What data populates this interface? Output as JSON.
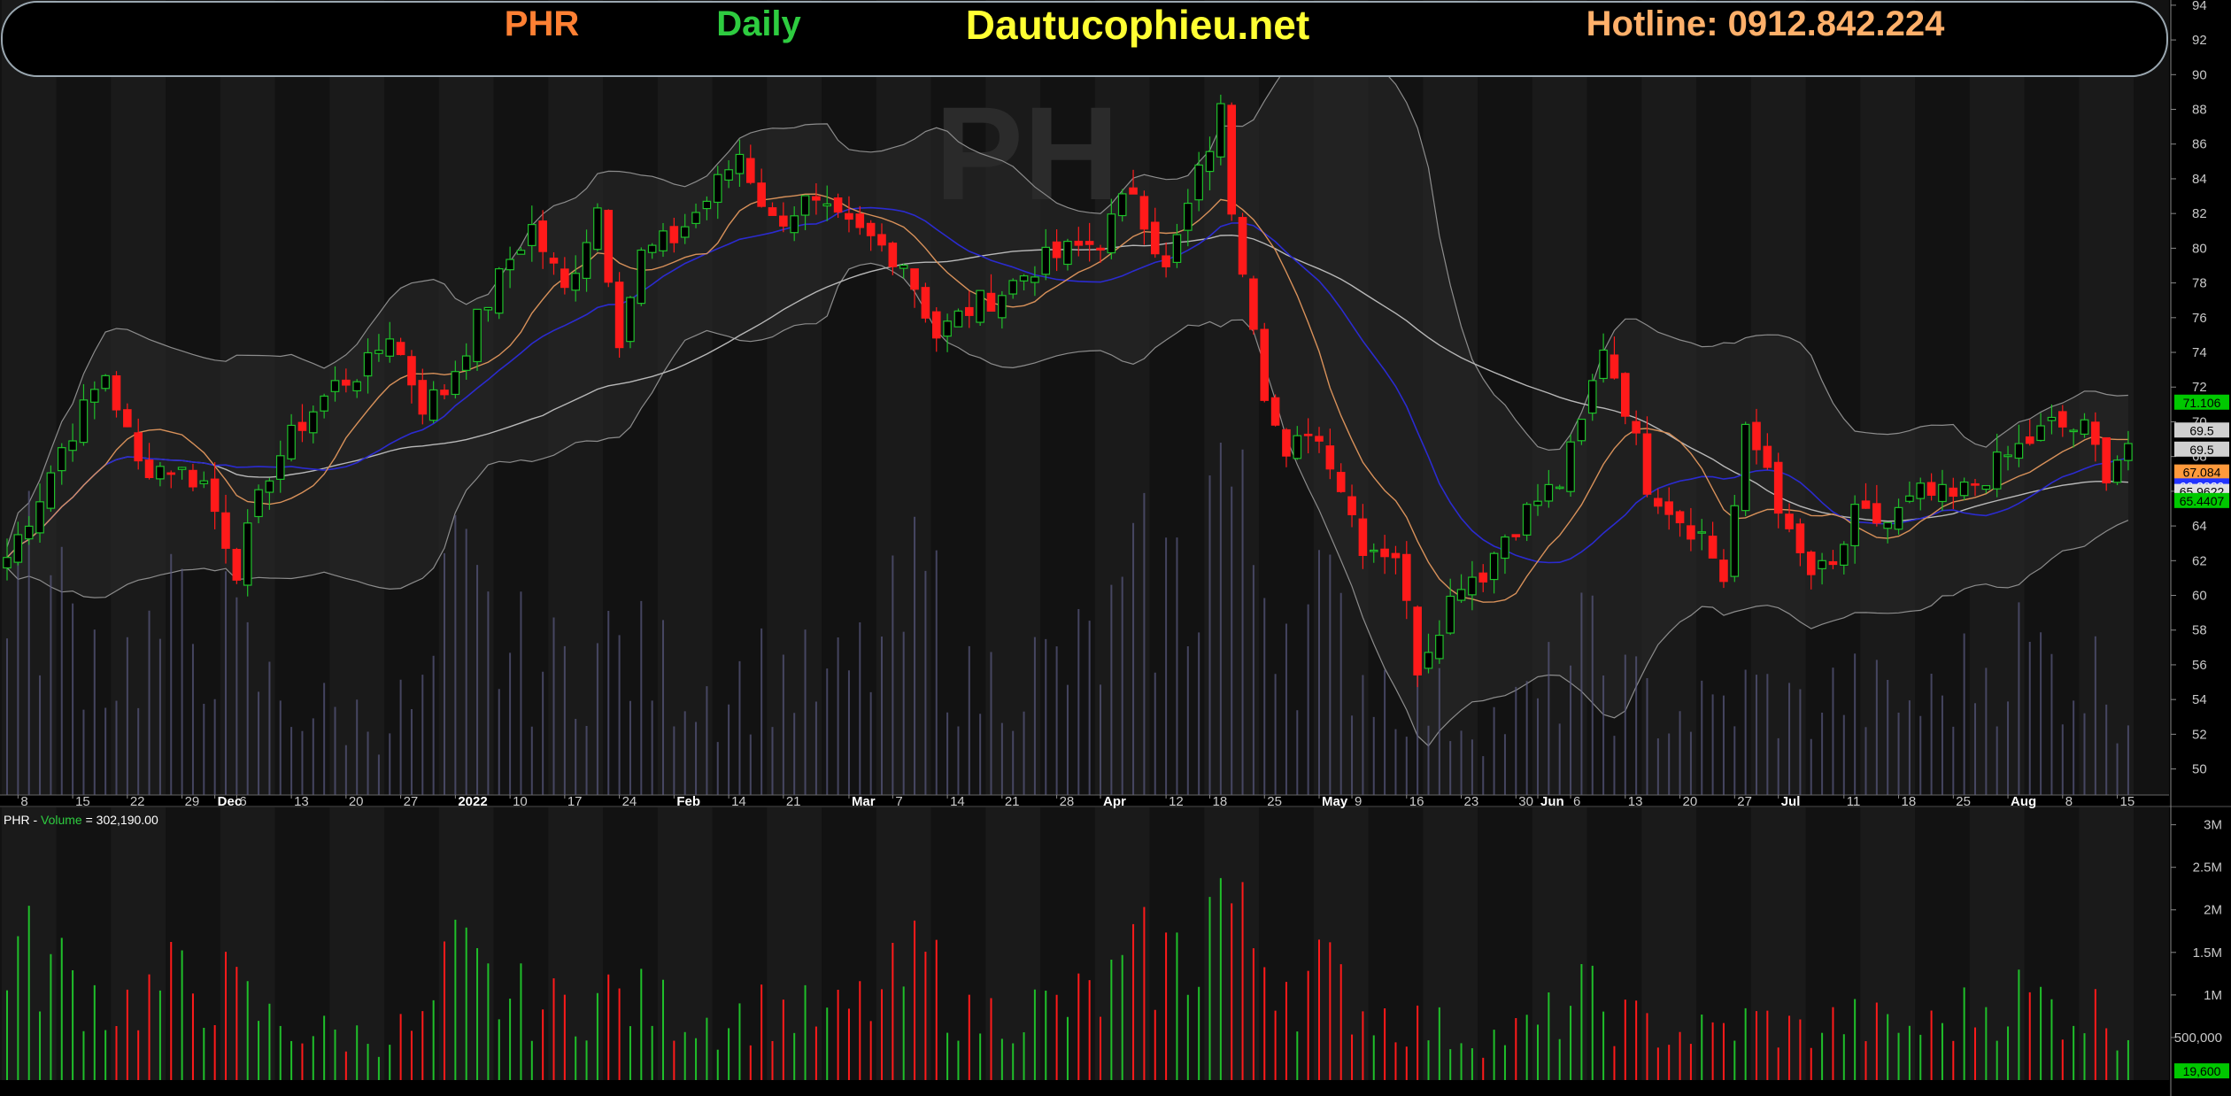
{
  "banner": {
    "symbol": "PHR",
    "interval": "Daily",
    "site": "Dautucophieu.net",
    "hotline": "Hotline: 0912.842.224",
    "watermark": "PH"
  },
  "colors": {
    "background": "#000000",
    "panel": "#121212",
    "up": "#1fbf2a",
    "down": "#ff1a1a",
    "ma_orange": "#d8915a",
    "ma_blue": "#2b2bd0",
    "ma_white": "#b8b8b8",
    "band": "#8c8c8c",
    "symbol": "#ff8033",
    "interval": "#2ecc40",
    "site": "#ffff33",
    "hotline": "#ffb06a"
  },
  "volume_legend": {
    "symbol": "PHR",
    "label": "Volume",
    "value": "= 302,190.00"
  },
  "chart_data": [
    {
      "type": "candlestick",
      "panel": "price",
      "y_ticks": [
        50,
        52,
        54,
        56,
        58,
        60,
        62,
        64,
        66,
        68,
        70,
        72,
        74,
        76,
        78,
        80,
        82,
        84,
        86,
        88,
        90,
        92,
        94
      ],
      "ylim": [
        48.5,
        94.3
      ],
      "date_labels": [
        {
          "t": "8",
          "i": 1
        },
        {
          "t": "15",
          "i": 6
        },
        {
          "t": "22",
          "i": 11
        },
        {
          "t": "29",
          "i": 16
        },
        {
          "t": "Dec",
          "i": 19,
          "bold": true
        },
        {
          "t": "6",
          "i": 21
        },
        {
          "t": "13",
          "i": 26
        },
        {
          "t": "20",
          "i": 31
        },
        {
          "t": "27",
          "i": 36
        },
        {
          "t": "2022",
          "i": 41,
          "bold": true
        },
        {
          "t": "10",
          "i": 46
        },
        {
          "t": "17",
          "i": 51
        },
        {
          "t": "24",
          "i": 56
        },
        {
          "t": "Feb",
          "i": 61,
          "bold": true
        },
        {
          "t": "14",
          "i": 66
        },
        {
          "t": "21",
          "i": 71
        },
        {
          "t": "Mar",
          "i": 77,
          "bold": true
        },
        {
          "t": "7",
          "i": 81
        },
        {
          "t": "14",
          "i": 86
        },
        {
          "t": "21",
          "i": 91
        },
        {
          "t": "28",
          "i": 96
        },
        {
          "t": "Apr",
          "i": 100,
          "bold": true
        },
        {
          "t": "12",
          "i": 106
        },
        {
          "t": "18",
          "i": 110
        },
        {
          "t": "25",
          "i": 115
        },
        {
          "t": "May",
          "i": 120,
          "bold": true
        },
        {
          "t": "9",
          "i": 123
        },
        {
          "t": "16",
          "i": 128
        },
        {
          "t": "23",
          "i": 133
        },
        {
          "t": "30",
          "i": 138
        },
        {
          "t": "Jun",
          "i": 140,
          "bold": true
        },
        {
          "t": "6",
          "i": 143
        },
        {
          "t": "13",
          "i": 148
        },
        {
          "t": "20",
          "i": 153
        },
        {
          "t": "27",
          "i": 158
        },
        {
          "t": "Jul",
          "i": 162,
          "bold": true
        },
        {
          "t": "11",
          "i": 168
        },
        {
          "t": "18",
          "i": 173
        },
        {
          "t": "25",
          "i": 178
        },
        {
          "t": "Aug",
          "i": 183,
          "bold": true
        },
        {
          "t": "8",
          "i": 188
        },
        {
          "t": "15",
          "i": 193
        }
      ],
      "last_values": [
        {
          "label": "71.106",
          "value": 71.106,
          "bg": "#00c800",
          "fg": "#000000"
        },
        {
          "label": "69.5",
          "value": 69.5,
          "bg": "#d0d0d0",
          "fg": "#000000"
        },
        {
          "label": "69.5",
          "value": 68.4,
          "bg": "#d0d0d0",
          "fg": "#000000"
        },
        {
          "label": "67.084",
          "value": 67.084,
          "bg": "#ff9a3c",
          "fg": "#000000"
        },
        {
          "label": "66.2829",
          "value": 66.2829,
          "bg": "#2233ff",
          "fg": "#ffffff"
        },
        {
          "label": "65.9622",
          "value": 65.9622,
          "bg": "#e0e0e0",
          "fg": "#000000"
        },
        {
          "label": "65.4407",
          "value": 65.4407,
          "bg": "#00c800",
          "fg": "#000000"
        }
      ],
      "anchors": [
        [
          0,
          62.2
        ],
        [
          3,
          65.8
        ],
        [
          5,
          68.5
        ],
        [
          9,
          72.8
        ],
        [
          12,
          67.5
        ],
        [
          15,
          67.4
        ],
        [
          18,
          66.5
        ],
        [
          21,
          61.6
        ],
        [
          24,
          67.2
        ],
        [
          27,
          70.0
        ],
        [
          30,
          72.1
        ],
        [
          33,
          73.2
        ],
        [
          35,
          75.2
        ],
        [
          38,
          71.0
        ],
        [
          40,
          71.8
        ],
        [
          43,
          75.8
        ],
        [
          46,
          79.4
        ],
        [
          48,
          81.2
        ],
        [
          51,
          77.5
        ],
        [
          54,
          82.4
        ],
        [
          56,
          75.0
        ],
        [
          58,
          79.6
        ],
        [
          61,
          80.6
        ],
        [
          64,
          82.8
        ],
        [
          67,
          85.5
        ],
        [
          70,
          81.5
        ],
        [
          73,
          82.6
        ],
        [
          76,
          81.4
        ],
        [
          79,
          80.5
        ],
        [
          82,
          79.3
        ],
        [
          85,
          75.0
        ],
        [
          88,
          76.5
        ],
        [
          91,
          77.5
        ],
        [
          94,
          79.0
        ],
        [
          97,
          79.8
        ],
        [
          100,
          80.5
        ],
        [
          103,
          83.5
        ],
        [
          106,
          78.6
        ],
        [
          109,
          84.2
        ],
        [
          111,
          87.8
        ],
        [
          112,
          82.5
        ],
        [
          114,
          76.0
        ],
        [
          115,
          72.0
        ],
        [
          117,
          67.5
        ],
        [
          119,
          69.8
        ],
        [
          121,
          68.0
        ],
        [
          124,
          63.0
        ],
        [
          127,
          62.5
        ],
        [
          129,
          56.0
        ],
        [
          131,
          58.5
        ],
        [
          133,
          61.0
        ],
        [
          135,
          61.4
        ],
        [
          137,
          63.5
        ],
        [
          140,
          65.5
        ],
        [
          142,
          66.5
        ],
        [
          144,
          69.8
        ],
        [
          146,
          74.5
        ],
        [
          148,
          71.0
        ],
        [
          150,
          66.5
        ],
        [
          153,
          64.5
        ],
        [
          155,
          63.5
        ],
        [
          157,
          61.0
        ],
        [
          159,
          69.2
        ],
        [
          161,
          67.5
        ],
        [
          163,
          63.2
        ],
        [
          165,
          61.2
        ],
        [
          167,
          61.5
        ],
        [
          169,
          64.5
        ],
        [
          172,
          64.2
        ],
        [
          175,
          65.8
        ],
        [
          178,
          65.5
        ],
        [
          181,
          67.0
        ],
        [
          184,
          68.5
        ],
        [
          187,
          69.8
        ],
        [
          190,
          69.5
        ],
        [
          192,
          67.2
        ],
        [
          194,
          68.8
        ]
      ],
      "volume_anchors": [
        [
          0,
          0.55
        ],
        [
          5,
          0.45
        ],
        [
          10,
          0.3
        ],
        [
          15,
          0.4
        ],
        [
          20,
          0.38
        ],
        [
          24,
          0.25
        ],
        [
          28,
          0.2
        ],
        [
          33,
          0.18
        ],
        [
          38,
          0.22
        ],
        [
          41,
          0.5
        ],
        [
          45,
          0.35
        ],
        [
          50,
          0.3
        ],
        [
          55,
          0.35
        ],
        [
          60,
          0.3
        ],
        [
          65,
          0.25
        ],
        [
          70,
          0.3
        ],
        [
          75,
          0.25
        ],
        [
          80,
          0.35
        ],
        [
          84,
          0.5
        ],
        [
          88,
          0.25
        ],
        [
          92,
          0.3
        ],
        [
          96,
          0.3
        ],
        [
          100,
          0.35
        ],
        [
          104,
          0.5
        ],
        [
          108,
          0.5
        ],
        [
          111,
          0.82
        ],
        [
          113,
          0.6
        ],
        [
          115,
          0.55
        ],
        [
          118,
          0.4
        ],
        [
          120,
          0.45
        ],
        [
          124,
          0.3
        ],
        [
          128,
          0.25
        ],
        [
          132,
          0.2
        ],
        [
          136,
          0.18
        ],
        [
          140,
          0.22
        ],
        [
          144,
          0.35
        ],
        [
          148,
          0.25
        ],
        [
          152,
          0.2
        ],
        [
          156,
          0.2
        ],
        [
          160,
          0.25
        ],
        [
          164,
          0.2
        ],
        [
          168,
          0.25
        ],
        [
          172,
          0.22
        ],
        [
          176,
          0.22
        ],
        [
          180,
          0.3
        ],
        [
          184,
          0.35
        ],
        [
          188,
          0.3
        ],
        [
          192,
          0.28
        ],
        [
          194,
          0.2
        ]
      ],
      "bars": 195
    },
    {
      "type": "bar",
      "panel": "volume",
      "series_name": "Volume",
      "y_ticks": [
        {
          "label": "3M",
          "value": 3000000
        },
        {
          "label": "2.5M",
          "value": 2500000
        },
        {
          "label": "2M",
          "value": 2000000
        },
        {
          "label": "1.5M",
          "value": 1500000
        },
        {
          "label": "1M",
          "value": 1000000
        },
        {
          "label": "500,000",
          "value": 500000
        }
      ],
      "ylim": [
        0,
        3100000
      ],
      "last_value": {
        "label": "19,600",
        "value": 19600,
        "bg": "#00c800",
        "fg": "#000000"
      }
    }
  ]
}
